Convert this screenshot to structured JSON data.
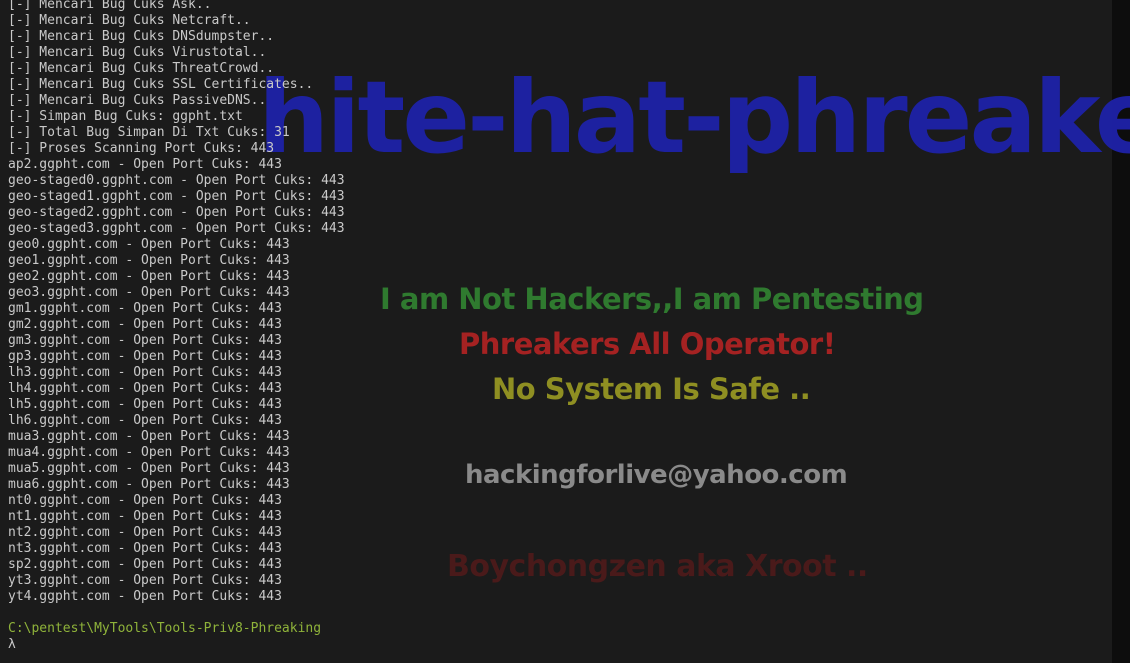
{
  "wallpaper": {
    "banner": "hite-hat-phreakers",
    "line1": "I am Not Hackers,,I am Pentesting",
    "line2": "Phreakers All Operator!",
    "line3": "No System Is Safe ..",
    "email": "hackingforlive@yahoo.com",
    "credit": "Boychongzen aka Xroot .."
  },
  "terminal": {
    "lines": [
      "[-] Mencari Bug Cuks Ask..",
      "[-] Mencari Bug Cuks Netcraft..",
      "[-] Mencari Bug Cuks DNSdumpster..",
      "[-] Mencari Bug Cuks Virustotal..",
      "[-] Mencari Bug Cuks ThreatCrowd..",
      "[-] Mencari Bug Cuks SSL Certificates..",
      "[-] Mencari Bug Cuks PassiveDNS..",
      "[-] Simpan Bug Cuks: ggpht.txt",
      "[-] Total Bug Simpan Di Txt Cuks: 31",
      "[-] Proses Scanning Port Cuks: 443",
      "ap2.ggpht.com - Open Port Cuks: 443",
      "geo-staged0.ggpht.com - Open Port Cuks: 443",
      "geo-staged1.ggpht.com - Open Port Cuks: 443",
      "geo-staged2.ggpht.com - Open Port Cuks: 443",
      "geo-staged3.ggpht.com - Open Port Cuks: 443",
      "geo0.ggpht.com - Open Port Cuks: 443",
      "geo1.ggpht.com - Open Port Cuks: 443",
      "geo2.ggpht.com - Open Port Cuks: 443",
      "geo3.ggpht.com - Open Port Cuks: 443",
      "gm1.ggpht.com - Open Port Cuks: 443",
      "gm2.ggpht.com - Open Port Cuks: 443",
      "gm3.ggpht.com - Open Port Cuks: 443",
      "gp3.ggpht.com - Open Port Cuks: 443",
      "lh3.ggpht.com - Open Port Cuks: 443",
      "lh4.ggpht.com - Open Port Cuks: 443",
      "lh5.ggpht.com - Open Port Cuks: 443",
      "lh6.ggpht.com - Open Port Cuks: 443",
      "mua3.ggpht.com - Open Port Cuks: 443",
      "mua4.ggpht.com - Open Port Cuks: 443",
      "mua5.ggpht.com - Open Port Cuks: 443",
      "mua6.ggpht.com - Open Port Cuks: 443",
      "nt0.ggpht.com - Open Port Cuks: 443",
      "nt1.ggpht.com - Open Port Cuks: 443",
      "nt2.ggpht.com - Open Port Cuks: 443",
      "nt3.ggpht.com - Open Port Cuks: 443",
      "sp2.ggpht.com - Open Port Cuks: 443",
      "yt3.ggpht.com - Open Port Cuks: 443",
      "yt4.ggpht.com - Open Port Cuks: 443"
    ],
    "prompt_path": "C:\\pentest\\MyTools\\Tools-Priv8-Phreaking",
    "prompt_symbol": "λ"
  },
  "colors": {
    "background": "#1b1b1b",
    "text": "#c9c9c9",
    "prompt_path": "#8fb33a",
    "banner": "#1e22a8"
  }
}
